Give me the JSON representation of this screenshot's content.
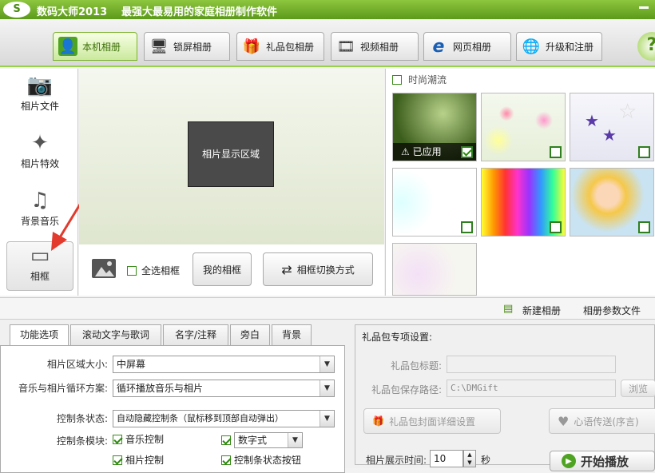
{
  "app": {
    "logo": "S",
    "name": "数码大师2013",
    "slogan": "最强大最易用的家庭相册制作软件",
    "help": "?"
  },
  "main_tabs": [
    {
      "label": "本机相册",
      "icon": "person-photo-icon",
      "glyph": "👤"
    },
    {
      "label": "锁屏相册",
      "icon": "monitor-icon",
      "glyph": "🖥"
    },
    {
      "label": "礼品包相册",
      "icon": "gift-icon",
      "glyph": "🎁"
    },
    {
      "label": "视频相册",
      "icon": "film-icon",
      "glyph": "🎞"
    },
    {
      "label": "网页相册",
      "icon": "browser-icon",
      "glyph": "e"
    },
    {
      "label": "升级和注册",
      "icon": "globe-icon",
      "glyph": "🌐"
    }
  ],
  "sidebar": {
    "items": [
      {
        "label": "相片文件",
        "glyph": "📷"
      },
      {
        "label": "相片特效",
        "glyph": "✦"
      },
      {
        "label": "背景音乐",
        "glyph": "♫"
      },
      {
        "label": "相框",
        "glyph": "▭"
      }
    ]
  },
  "preview": {
    "placeholder": "相片显示区域"
  },
  "frame_toolbar": {
    "select_all": "全选相框",
    "my_frames": "我的相框",
    "switch_mode": "相框切换方式"
  },
  "gallery": {
    "category": "时尚潮流",
    "applied_label": "已应用"
  },
  "actions": {
    "new_album": "新建相册",
    "album_params": "相册参数文件"
  },
  "sub_tabs": [
    "功能选项",
    "滚动文字与歌词",
    "名字/注释",
    "旁白",
    "背景"
  ],
  "options": {
    "area_size_label": "相片区域大小:",
    "area_size_value": "中屏幕",
    "loop_label": "音乐与相片循环方案:",
    "loop_value": "循环播放音乐与相片",
    "bar_state_label": "控制条状态:",
    "bar_state_value": "自动隐藏控制条（鼠标移到顶部自动弹出）",
    "bar_module_label": "控制条模块:",
    "module_music": "音乐控制",
    "module_photo": "相片控制",
    "module_number": "数字式",
    "module_state_btn": "控制条状态按钮"
  },
  "gift": {
    "section_title": "礼品包专项设置:",
    "title_label": "礼品包标题:",
    "title_value": "",
    "path_label": "礼品包保存路径:",
    "path_value": "C:\\DMGift",
    "browse": "浏览",
    "cover_button": "礼品包封面详细设置",
    "blessing_button": "心语传送(序言)",
    "duration_label": "相片展示时间:",
    "duration_value": "10",
    "duration_unit": "秒",
    "start_button": "开始播放"
  },
  "colors": {
    "brand_green": "#6aa822",
    "accent_red": "#e23b2e"
  }
}
